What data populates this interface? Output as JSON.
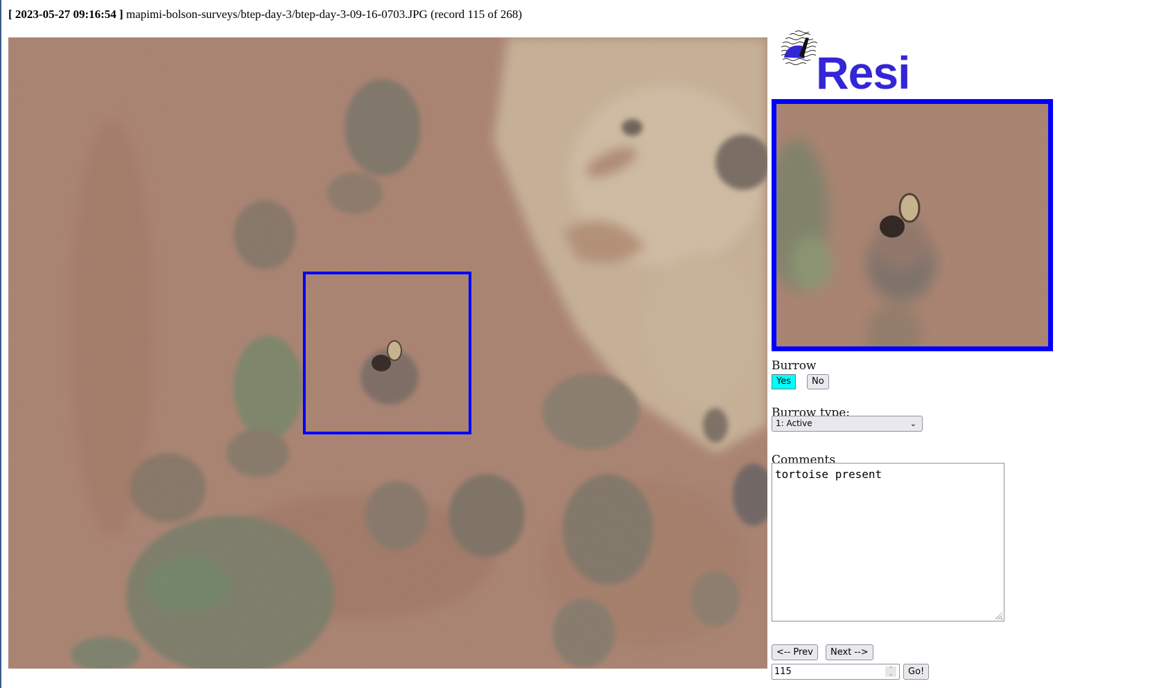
{
  "header": {
    "timestamp": "[ 2023-05-27 09:16:54 ]",
    "path": "mapimi-bolson-surveys/btep-day-3/btep-day-3-09-16-0703.JPG",
    "record_info": "(record 115 of 268)"
  },
  "logo": {
    "text": "Resi",
    "icon": "tortoise-waves-logo-icon",
    "color": "#3326d6"
  },
  "image": {
    "description": "aerial photo of desert terrain with shrubs and a tortoise at a burrow",
    "highlight_color": "#0000ff"
  },
  "form": {
    "burrow_label": "Burrow",
    "yes_label": "Yes",
    "no_label": "No",
    "burrow_selected": "Yes",
    "active_color": "#00ffff",
    "burrow_type_label": "Burrow type:",
    "burrow_type_value": "1: Active",
    "comments_label": "Comments",
    "comments_value": "tortoise present",
    "prev_label": "<-- Prev",
    "next_label": "Next -->",
    "record_number": "115",
    "go_label": "Go!"
  }
}
